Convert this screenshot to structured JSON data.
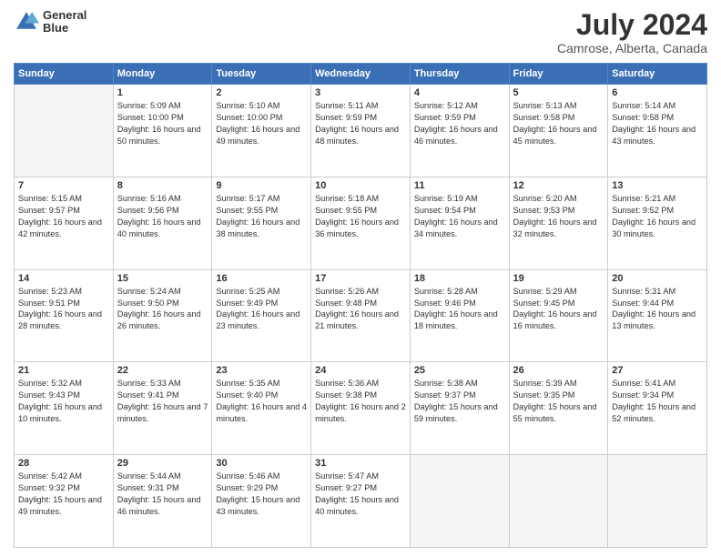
{
  "logo": {
    "line1": "General",
    "line2": "Blue"
  },
  "title": "July 2024",
  "subtitle": "Camrose, Alberta, Canada",
  "weekdays": [
    "Sunday",
    "Monday",
    "Tuesday",
    "Wednesday",
    "Thursday",
    "Friday",
    "Saturday"
  ],
  "weeks": [
    [
      {
        "day": "",
        "empty": true
      },
      {
        "day": "1",
        "sunrise": "5:09 AM",
        "sunset": "10:00 PM",
        "daylight": "16 hours and 50 minutes."
      },
      {
        "day": "2",
        "sunrise": "5:10 AM",
        "sunset": "10:00 PM",
        "daylight": "16 hours and 49 minutes."
      },
      {
        "day": "3",
        "sunrise": "5:11 AM",
        "sunset": "9:59 PM",
        "daylight": "16 hours and 48 minutes."
      },
      {
        "day": "4",
        "sunrise": "5:12 AM",
        "sunset": "9:59 PM",
        "daylight": "16 hours and 46 minutes."
      },
      {
        "day": "5",
        "sunrise": "5:13 AM",
        "sunset": "9:58 PM",
        "daylight": "16 hours and 45 minutes."
      },
      {
        "day": "6",
        "sunrise": "5:14 AM",
        "sunset": "9:58 PM",
        "daylight": "16 hours and 43 minutes."
      }
    ],
    [
      {
        "day": "7",
        "sunrise": "5:15 AM",
        "sunset": "9:57 PM",
        "daylight": "16 hours and 42 minutes."
      },
      {
        "day": "8",
        "sunrise": "5:16 AM",
        "sunset": "9:56 PM",
        "daylight": "16 hours and 40 minutes."
      },
      {
        "day": "9",
        "sunrise": "5:17 AM",
        "sunset": "9:55 PM",
        "daylight": "16 hours and 38 minutes."
      },
      {
        "day": "10",
        "sunrise": "5:18 AM",
        "sunset": "9:55 PM",
        "daylight": "16 hours and 36 minutes."
      },
      {
        "day": "11",
        "sunrise": "5:19 AM",
        "sunset": "9:54 PM",
        "daylight": "16 hours and 34 minutes."
      },
      {
        "day": "12",
        "sunrise": "5:20 AM",
        "sunset": "9:53 PM",
        "daylight": "16 hours and 32 minutes."
      },
      {
        "day": "13",
        "sunrise": "5:21 AM",
        "sunset": "9:52 PM",
        "daylight": "16 hours and 30 minutes."
      }
    ],
    [
      {
        "day": "14",
        "sunrise": "5:23 AM",
        "sunset": "9:51 PM",
        "daylight": "16 hours and 28 minutes."
      },
      {
        "day": "15",
        "sunrise": "5:24 AM",
        "sunset": "9:50 PM",
        "daylight": "16 hours and 26 minutes."
      },
      {
        "day": "16",
        "sunrise": "5:25 AM",
        "sunset": "9:49 PM",
        "daylight": "16 hours and 23 minutes."
      },
      {
        "day": "17",
        "sunrise": "5:26 AM",
        "sunset": "9:48 PM",
        "daylight": "16 hours and 21 minutes."
      },
      {
        "day": "18",
        "sunrise": "5:28 AM",
        "sunset": "9:46 PM",
        "daylight": "16 hours and 18 minutes."
      },
      {
        "day": "19",
        "sunrise": "5:29 AM",
        "sunset": "9:45 PM",
        "daylight": "16 hours and 16 minutes."
      },
      {
        "day": "20",
        "sunrise": "5:31 AM",
        "sunset": "9:44 PM",
        "daylight": "16 hours and 13 minutes."
      }
    ],
    [
      {
        "day": "21",
        "sunrise": "5:32 AM",
        "sunset": "9:43 PM",
        "daylight": "16 hours and 10 minutes."
      },
      {
        "day": "22",
        "sunrise": "5:33 AM",
        "sunset": "9:41 PM",
        "daylight": "16 hours and 7 minutes."
      },
      {
        "day": "23",
        "sunrise": "5:35 AM",
        "sunset": "9:40 PM",
        "daylight": "16 hours and 4 minutes."
      },
      {
        "day": "24",
        "sunrise": "5:36 AM",
        "sunset": "9:38 PM",
        "daylight": "16 hours and 2 minutes."
      },
      {
        "day": "25",
        "sunrise": "5:38 AM",
        "sunset": "9:37 PM",
        "daylight": "15 hours and 59 minutes."
      },
      {
        "day": "26",
        "sunrise": "5:39 AM",
        "sunset": "9:35 PM",
        "daylight": "15 hours and 55 minutes."
      },
      {
        "day": "27",
        "sunrise": "5:41 AM",
        "sunset": "9:34 PM",
        "daylight": "15 hours and 52 minutes."
      }
    ],
    [
      {
        "day": "28",
        "sunrise": "5:42 AM",
        "sunset": "9:32 PM",
        "daylight": "15 hours and 49 minutes."
      },
      {
        "day": "29",
        "sunrise": "5:44 AM",
        "sunset": "9:31 PM",
        "daylight": "15 hours and 46 minutes."
      },
      {
        "day": "30",
        "sunrise": "5:46 AM",
        "sunset": "9:29 PM",
        "daylight": "15 hours and 43 minutes."
      },
      {
        "day": "31",
        "sunrise": "5:47 AM",
        "sunset": "9:27 PM",
        "daylight": "15 hours and 40 minutes."
      },
      {
        "day": "",
        "empty": true
      },
      {
        "day": "",
        "empty": true
      },
      {
        "day": "",
        "empty": true
      }
    ]
  ]
}
